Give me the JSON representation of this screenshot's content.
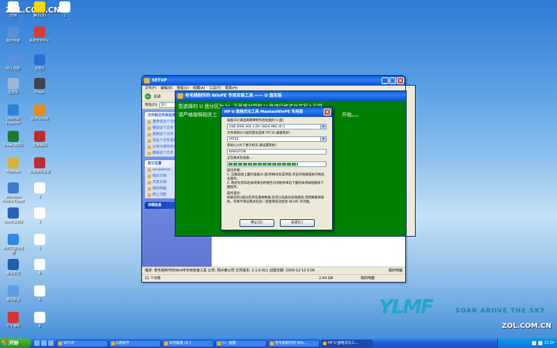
{
  "watermark": "ZOL.COM.CN",
  "watermark_bottom": "ZOL.COM.CN",
  "desktop": {
    "icons": [
      {
        "label": "文档",
        "color": "#ffffff"
      },
      {
        "label": "腾讯QQ",
        "color": "#ffd400"
      },
      {
        "label": "1",
        "color": "#ffffff"
      },
      {
        "label": "我的电脑",
        "color": "#5b8fd9"
      },
      {
        "label": "系统安全中心",
        "color": "#d63b2f"
      },
      {
        "label": "网上邻居",
        "color": "#5b8fd9"
      },
      {
        "label": "迅雷5",
        "color": "#2c6fd0"
      },
      {
        "label": "回收站",
        "color": "#9ab8d6"
      },
      {
        "label": "Fraps",
        "color": "#444444"
      },
      {
        "label": "Internet Explorer",
        "color": "#2b82d9"
      },
      {
        "label": "3DMark06",
        "color": "#e48b1c"
      },
      {
        "label": "Excel 2003",
        "color": "#1e7b34"
      },
      {
        "label": "完美解码",
        "color": "#c02c2c"
      },
      {
        "label": "Foxmail",
        "color": "#d9b13a"
      },
      {
        "label": "完美解码设置",
        "color": "#c02c2c"
      },
      {
        "label": "Windows Media Player",
        "color": "#3a7bd5"
      },
      {
        "label": "2",
        "color": "#ffffff"
      },
      {
        "label": "Word 2003",
        "color": "#2b5fb8"
      },
      {
        "label": "3",
        "color": "#ffffff"
      },
      {
        "label": "世界之窗浏览器",
        "color": "#2d8ae0"
      },
      {
        "label": "5",
        "color": "#ffffff"
      },
      {
        "label": "暴风影音",
        "color": "#1d5fb0"
      },
      {
        "label": "4",
        "color": "#ffffff"
      },
      {
        "label": "暴风影音",
        "color": "#5aa0e4"
      },
      {
        "label": "6",
        "color": "#ffffff"
      },
      {
        "label": "千千静听",
        "color": "#d9342f"
      },
      {
        "label": "8",
        "color": "#ffffff"
      }
    ]
  },
  "explorer": {
    "title": "SETUP",
    "menu": [
      "文件(F)",
      "编辑(E)",
      "查看(V)",
      "收藏(A)",
      "工具(T)",
      "帮助(H)"
    ],
    "back_label": "后退",
    "address_label": "地址(D)",
    "address_value": "G:\\",
    "tasks_group": {
      "title": "文件和文件夹任务",
      "items": [
        "重命名这个文件",
        "移动这个文件",
        "复制这个文件",
        "将这个文件发布到 Web",
        "以电子邮件形式发送此文件",
        "删除这个文件"
      ]
    },
    "places_group": {
      "title": "其它位置",
      "items": [
        "winpeboot",
        "我的文档",
        "共享文档",
        "我的电脑",
        "网上邻居"
      ]
    },
    "details_group": {
      "title": "详细信息"
    },
    "status_left": "描述: 老毛桃制作的WinPE专用安装工具 公司: 扬州某公司 文件版本: 2.1.0.911 创建日期: 2009-12-12 0:00",
    "status_right": "我的电脑",
    "status2_left": "11 个对象",
    "status2_mid": "2.44 GB",
    "status2_right": "我的电脑"
  },
  "green_window": {
    "title": "老毛桃制作的 WinPE 专用安装工具 —— U 盘安装",
    "line1": "您选择的 U 盘分区为 hi, 下面将对您的 U 盘进行格式化并写入引导",
    "line2_left": "请严格按照相关工",
    "line2_right": "开始。。。"
  },
  "dialog": {
    "title": "HP U 盘格式化工具 MaotaoWinPE 专用版",
    "device_label": "设备(D)(请选择需要制作启动盘的 U 盘)",
    "device_value": "USB DISK 30X 1.00 (3824 MB) (K:\\)",
    "fs_label": "文件系统(F)(强烈建议选择 FAT32,兼容性好)",
    "fs_value": "FAT32",
    "volume_label": "卷标(L)(为了便于标识,请设置卷标)",
    "volume_value": "KINGSTON",
    "progress_text": "正在格式化设备...",
    "progress": 0.72,
    "steps_title": "操作步骤:",
    "steps": [
      "1. 正确选择上面的设备(U 盘)和格式化选项后,点击开始按钮执行格式化操作。",
      "2. 格式化完毕后关闭弹出的报告对话框并单击下面的关闭按钮继续下面程序。"
    ],
    "tips_title": "操作提示:",
    "tips": "如果您的U盘分区存在重要数据,您可以先备份后再继续,否则数据将丢失。作者不保证格式化后一定能够成功启动 WinPE 的功能。",
    "stop_button": "停止(S)",
    "close_button": "关闭(C)"
  },
  "logo": {
    "mark": "YLMF",
    "slogan": "SOAR ABOVE THE SKY"
  },
  "taskbar": {
    "start_label": "开始",
    "tasks": [
      {
        "label": "SETUP",
        "active": false
      },
      {
        "label": "D盘制作",
        "active": false
      },
      {
        "label": "本地磁盘 (D:)",
        "active": false
      },
      {
        "label": "(c - 画图",
        "active": false
      },
      {
        "label": "老毛桃制作的 Win...",
        "active": false
      },
      {
        "label": "HP U 盘格式化工...",
        "active": true
      }
    ],
    "clock": "22:34"
  }
}
